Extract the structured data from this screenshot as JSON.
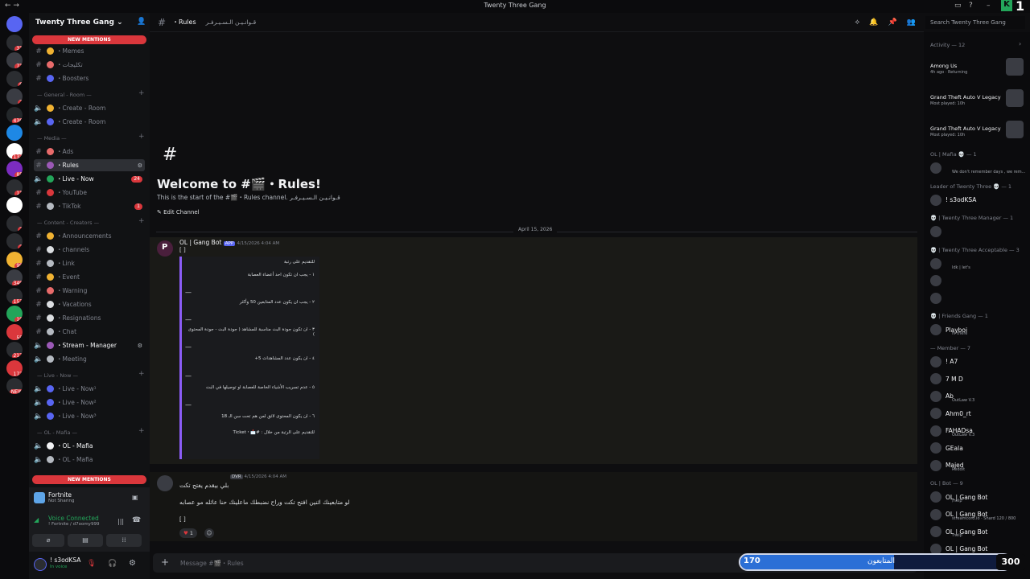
{
  "window": {
    "title": "Twenty Three Gang",
    "corner_number": "1"
  },
  "servers": [
    {
      "badge": ""
    },
    {
      "badge": "31"
    },
    {
      "badge": "71"
    },
    {
      "badge": "6"
    },
    {
      "badge": "7"
    },
    {
      "badge": "436"
    },
    {
      "badge": ""
    },
    {
      "badge": "132"
    },
    {
      "badge": "85"
    },
    {
      "badge": "11"
    },
    {
      "badge": ""
    },
    {
      "badge": "2"
    },
    {
      "badge": "2"
    },
    {
      "badge": "99"
    },
    {
      "badge": "349"
    },
    {
      "badge": "153"
    },
    {
      "badge": "10"
    },
    {
      "badge": "55"
    },
    {
      "badge": "212"
    },
    {
      "badge": "172"
    },
    {
      "badge": "NEW"
    }
  ],
  "sidebar": {
    "server_name": "Twenty Three Gang",
    "top_pill": "NEW MENTIONS",
    "bottom_pill": "NEW MENTIONS",
    "categories": [
      "— General - Room —",
      "— Media —",
      "— Content - Creators —",
      "— Live - Now —",
      "— OL - Mafia —"
    ],
    "channels": [
      {
        "name": "・Memes",
        "kind": "text",
        "color": "#f0b232"
      },
      {
        "name": "・تكليجات",
        "kind": "text",
        "color": "#e86b6b"
      },
      {
        "name": "・Boosters",
        "kind": "text",
        "color": "#5865f2"
      },
      {
        "name": "・Create - Room",
        "kind": "voice",
        "color": "#f0b232"
      },
      {
        "name": "・Create - Room",
        "kind": "voice",
        "color": "#5865f2"
      },
      {
        "name": "・Ads",
        "kind": "text",
        "color": "#e86b6b"
      },
      {
        "name": "・Rules",
        "kind": "text",
        "color": "#9b59b6"
      },
      {
        "name": "・Live - Now",
        "kind": "voice",
        "color": "#23a55a",
        "count": "24"
      },
      {
        "name": "・YouTube",
        "kind": "text",
        "color": "#da373c"
      },
      {
        "name": "・TikTok",
        "kind": "text",
        "color": "#b5bac1",
        "count": "1"
      },
      {
        "name": "・Announcements",
        "kind": "text",
        "color": "#f0b232"
      },
      {
        "name": "・channels",
        "kind": "text",
        "color": "#dbdee1"
      },
      {
        "name": "・Link",
        "kind": "text",
        "color": "#b5bac1"
      },
      {
        "name": "・Event",
        "kind": "text",
        "color": "#f0b232"
      },
      {
        "name": "・Warning",
        "kind": "text",
        "color": "#e86b6b"
      },
      {
        "name": "・Vacations",
        "kind": "text",
        "color": "#dbdee1"
      },
      {
        "name": "・Resignations",
        "kind": "text",
        "color": "#dbdee1"
      },
      {
        "name": "・Chat",
        "kind": "text",
        "color": "#b5bac1"
      },
      {
        "name": "・Stream - Manager",
        "kind": "voice",
        "color": "#9b59b6"
      },
      {
        "name": "・Meeting",
        "kind": "voice",
        "color": "#b5bac1"
      },
      {
        "name": "・Live - Now¹",
        "kind": "voice",
        "color": "#5865f2"
      },
      {
        "name": "・Live - Now²",
        "kind": "voice",
        "color": "#5865f2"
      },
      {
        "name": "・Live - Now³",
        "kind": "voice",
        "color": "#5865f2"
      },
      {
        "name": "・OL - Mafia",
        "kind": "voice",
        "color": "#f2f3f5"
      },
      {
        "name": "・OL - Mafia",
        "kind": "voice",
        "color": "#b5bac1"
      }
    ],
    "activity": {
      "game": "Fortnite",
      "status": "Not Sharing"
    },
    "voice": {
      "label": "Voice Connected",
      "detail": "! Fortnite / d7oomy999"
    },
    "user": {
      "name": "! s3odKSA",
      "status": "In voice"
    }
  },
  "header": {
    "channel": "・Rules",
    "topic": "قـوانـيـن الـسـيـرفـر"
  },
  "search": {
    "placeholder": "Search Twenty Three Gang"
  },
  "welcome": {
    "hash": "#",
    "title": "Welcome to #🎬・Rules!",
    "subtitle": "This is the start of the #🎬・Rules channel. قـوانـيـن الـسـيـرفـر",
    "edit": "Edit Channel",
    "date": "April 15, 2026"
  },
  "message1": {
    "author": "OL | Gang Bot",
    "tag": "APP",
    "time": "4/15/2026 4:04 AM",
    "bracket": "[ ]",
    "lines": [
      "للتقديم على رتبة",
      "١ - يجب ان تكون احد أعضاء العصابة",
      "—",
      "٢ - يجب ان يكون عدد المتابعين 50 وأكثر",
      "—",
      "٣ - ان تكون جودة البث مناسبة للمشاهد ( جودة البث - جودة المحتوى )",
      "—",
      "٤ - ان يكون عدد المشاهدات 5+",
      "—",
      "٥ - عدم تسريب الأشياء الخاصة للعصابة او توصيلها في البث",
      "—",
      "٦ - ان يكون المحتوى لائق لمن هم تحت سن الـ 18",
      "للتقديم على الرتبة من خلال : #📩・Ticket"
    ]
  },
  "message2": {
    "tag": "DVR",
    "time": "4/15/2026 4:04 AM",
    "lines": [
      "بلي بيقدم يفتح تكت",
      "لو متابعينك اثنين افتح تكت وراح نضبطك ماعلينك حنا عائله مو عصابه"
    ],
    "bracket": "[ ]",
    "reaction": "1"
  },
  "composer": {
    "placeholder": "Message #🎬・Rules"
  },
  "members": {
    "activity_title": "Activity — 12",
    "activities": [
      {
        "name": "Among Us",
        "detail": "4h ago · Returning"
      },
      {
        "name": "Grand Theft Auto V Legacy",
        "detail": "Most played: 10h"
      },
      {
        "name": "Grand Theft Auto V Legacy",
        "detail": "Most played: 10h"
      }
    ],
    "sections": [
      {
        "title": "OL | Mafia 💀 — 1",
        "rows": [
          {
            "name": "",
            "sub": "We don't remember days , we rem..."
          }
        ]
      },
      {
        "title": "Leader of Twenty Three 💀 — 1",
        "rows": [
          {
            "name": "! s3odKSA",
            "sub": ""
          }
        ]
      },
      {
        "title": "💀 | Twenty Three Manager — 1",
        "rows": [
          {
            "name": "",
            "sub": ""
          }
        ]
      },
      {
        "title": "💀 | Twenty Three Acceptable — 3",
        "rows": [
          {
            "name": "",
            "sub": "Idk | let's"
          },
          {
            "name": "",
            "sub": ""
          },
          {
            "name": "",
            "sub": ""
          }
        ]
      },
      {
        "title": "💀 | Friends Gang — 1",
        "rows": [
          {
            "name": "Playboi",
            "sub": "hi there"
          }
        ]
      },
      {
        "title": "— Member — 7",
        "rows": [
          {
            "name": "! A7",
            "sub": ""
          },
          {
            "name": "7 M D",
            "sub": ""
          },
          {
            "name": "Ab",
            "sub": "OutLaw V.3"
          },
          {
            "name": "Ahm0_rt",
            "sub": ""
          },
          {
            "name": "FAHADsa",
            "sub": "OutLaw V.3"
          },
          {
            "name": "GEala",
            "sub": ""
          },
          {
            "name": "Majed",
            "sub": "Reddit"
          }
        ]
      },
      {
        "title": "OL | Bot — 9",
        "rows": [
          {
            "name": "OL | Gang Bot",
            "sub": "/help"
          },
          {
            "name": "OL | Gang Bot",
            "sub": "streamcord.io · Shard 120 / 800"
          },
          {
            "name": "OL | Gang Bot",
            "sub": "!help"
          },
          {
            "name": "OL | Gang Bot",
            "sub": ""
          }
        ]
      }
    ]
  },
  "follow_overlay": {
    "left_value": "170",
    "label": "المتابعون",
    "right_value": "300",
    "progress": 0.567
  }
}
